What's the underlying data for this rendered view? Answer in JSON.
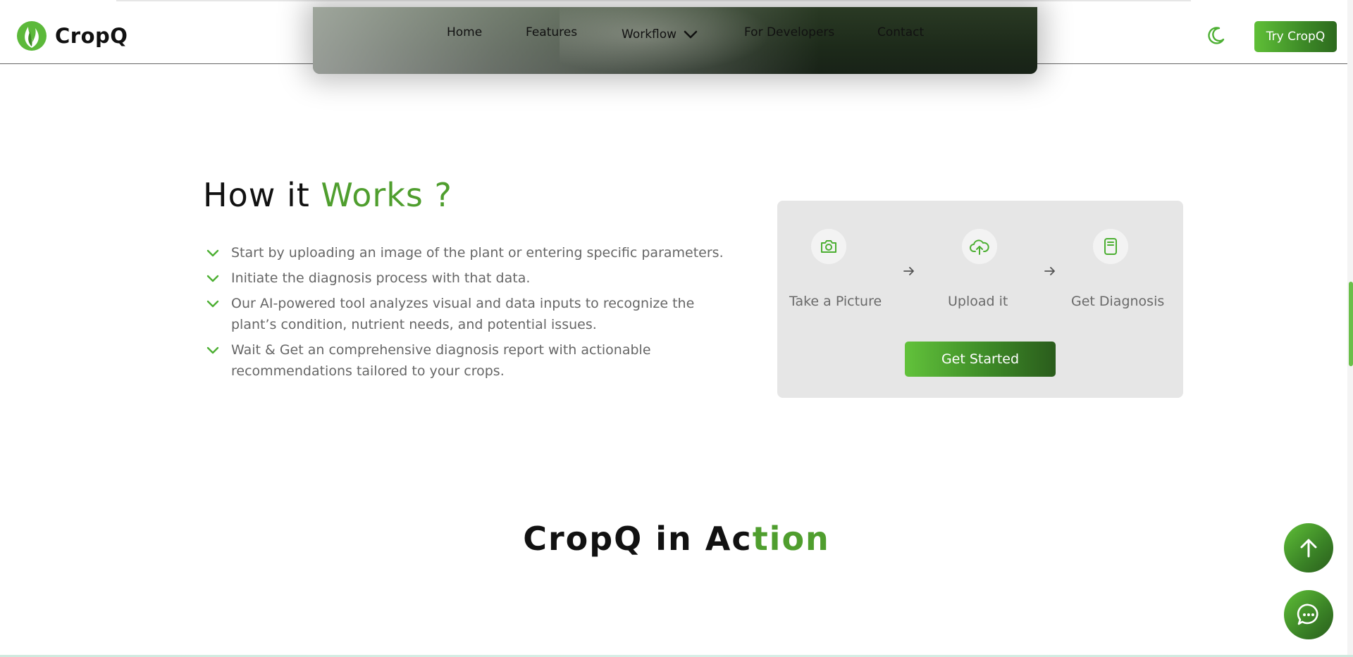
{
  "brand": {
    "name": "CropQ",
    "accent": "#4f9e2e"
  },
  "nav": {
    "items": [
      {
        "label": "Home"
      },
      {
        "label": "Features"
      },
      {
        "label": "Workflow"
      },
      {
        "label": "For Developers"
      },
      {
        "label": "Contact"
      }
    ],
    "try_label": "Try CropQ"
  },
  "how_it_works": {
    "title_plain": "How it",
    "title_accent": "Works ?",
    "steps": [
      {
        "text": "Start by uploading an image of the plant or entering specific parameters."
      },
      {
        "text": "Initiate the diagnosis process with that data."
      },
      {
        "text": "Our AI-powered tool analyzes visual and data inputs to recognize the plant’s condition, nutrient needs, and potential issues."
      },
      {
        "text": "Wait & Get an comprehensive diagnosis report with actionable recommendations tailored to your crops."
      }
    ],
    "card": {
      "stages": [
        {
          "label": "Take a Picture",
          "icon": "camera-icon"
        },
        {
          "label": "Upload it",
          "icon": "cloud-upload-icon"
        },
        {
          "label": "Get Diagnosis",
          "icon": "report-icon"
        }
      ],
      "cta_label": "Get Started"
    }
  },
  "in_action": {
    "title_plain": "CropQ in Ac",
    "title_accent": "tion"
  }
}
